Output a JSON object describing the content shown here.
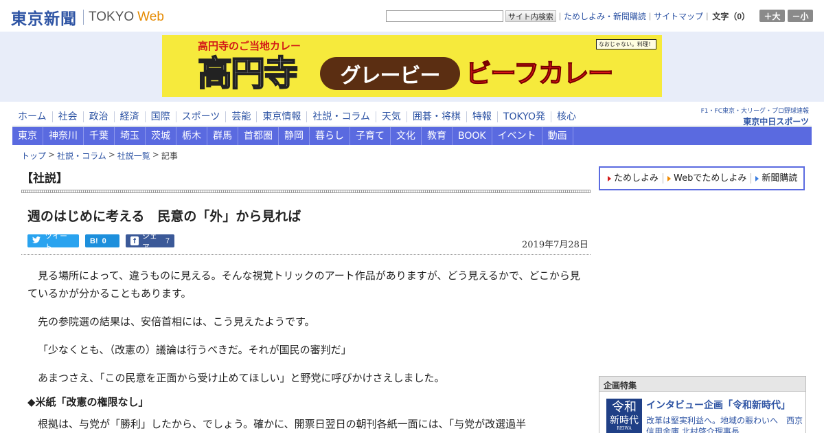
{
  "header": {
    "logo_jp": "東京新聞",
    "logo_en": "TOKYO",
    "logo_web": "Web",
    "search_placeholder": "",
    "search_button": "サイト内検索",
    "links": [
      "ためしよみ・新聞購読",
      "サイトマップ"
    ],
    "font_label": "文字（0）",
    "font_larger": "＋大",
    "font_smaller": "－小"
  },
  "ad": {
    "subtitle": "高円寺のご当地カレー",
    "tag": "なおじゃない。料理！",
    "main_text": "高円寺",
    "pill_text": "グレービー",
    "beef_text": "ビーフカレー"
  },
  "nav_primary": [
    "ホーム",
    "社会",
    "政治",
    "経済",
    "国際",
    "スポーツ",
    "芸能",
    "東京情報",
    "社説・コラム",
    "天気",
    "囲碁・将棋",
    "特報",
    "TOKYO発",
    "核心"
  ],
  "partner": {
    "top": "F1・FC東京・大リーグ・プロ野球速報",
    "bottom": "東京中日スポーツ"
  },
  "nav_regional": [
    "東京",
    "神奈川",
    "千葉",
    "埼玉",
    "茨城",
    "栃木",
    "群馬",
    "首都圏",
    "静岡",
    "暮らし",
    "子育て",
    "文化",
    "教育",
    "BOOK",
    "イベント",
    "動画"
  ],
  "breadcrumb": [
    {
      "label": "トップ",
      "link": true
    },
    {
      "label": "社説・コラム",
      "link": true
    },
    {
      "label": "社説一覧",
      "link": true
    },
    {
      "label": "記事",
      "link": false
    }
  ],
  "article": {
    "section": "【社説】",
    "title": "週のはじめに考える　民意の「外」から見れば",
    "date": "2019年7月28日",
    "share": {
      "tweet_label": "ツイート",
      "hatena_label": "B!",
      "hatena_count": "0",
      "facebook_label": "シェア",
      "facebook_count": "7"
    },
    "paragraphs": [
      "見る場所によって、違うものに見える。そんな視覚トリックのアート作品がありますが、どう見えるかで、どこから見ているかが分かることもあります。",
      "先の参院選の結果は、安倍首相には、こう見えたようです。",
      "「少なくとも、（改憲の）議論は行うべきだ。それが国民の審判だ」",
      "あまつさえ、「この民意を正面から受け止めてほしい」と野党に呼びかけさえしました。"
    ],
    "subheading": "◆米紙「改憲の権限なし」",
    "paragraph_after": "根拠は、与党が「勝利」したから、でしょう。確かに、開票日翌日の朝刊各紙一面には、「与党が改選過半"
  },
  "sidebar": {
    "promo": [
      "ためしよみ",
      "Webでためしよみ",
      "新聞購読"
    ],
    "feature_heading": "企画特集",
    "feature_thumb": [
      "令和",
      "新時代",
      "REIWA"
    ],
    "feature_title": "インタビュー企画「令和新時代」",
    "feature_desc": "改革は堅実利益へ。地域の賑わいへ　西京信用金庫 北村啓介理事長"
  },
  "colors": {
    "brand_blue": "#2e54a4",
    "nav_band": "#5a6ae0",
    "twitter": "#2aa3ef",
    "hatena": "#1d8fdc",
    "facebook": "#3b5998",
    "ad_yellow": "#f6ea3c"
  }
}
